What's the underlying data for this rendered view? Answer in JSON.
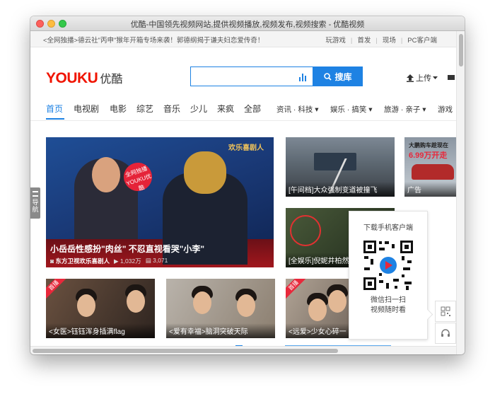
{
  "window": {
    "title": "优酷-中国领先视频网站,提供视频播放,视频发布,视频搜索 - 优酷视频"
  },
  "topbar": {
    "promo": "<全网独播>德云社\"丙申\"猴年开箱专场来袭！郭德纲揭于谦夫妇恋爱传奇！",
    "links": [
      "玩游戏",
      "首发",
      "现场",
      "PC客户端"
    ]
  },
  "header": {
    "logo_latin": "YOUKU",
    "logo_cn": "优酷",
    "search_placeholder": "",
    "search_button": "搜库",
    "upload": "上传"
  },
  "nav": {
    "items": [
      "首页",
      "电视剧",
      "电影",
      "综艺",
      "音乐",
      "少儿",
      "来疯",
      "全部"
    ],
    "subs": [
      "资讯 · 科技",
      "娱乐 · 搞笑",
      "旅游 · 亲子",
      "游戏"
    ],
    "active": "首页"
  },
  "sidetab": {
    "label": "导航"
  },
  "hero": {
    "stamp": "全网独播 YOUKU优酷",
    "show_logo": "欢乐喜剧人",
    "title": "小岳岳性感扮\"肉丝\" 不忍直视看哭\"小李\"",
    "channel": "东方卫视欢乐喜剧人",
    "views": "1,032万",
    "comments": "3,071"
  },
  "tiles": {
    "road": "[午间档]大众强制变道被撞飞",
    "ad_caption": "广告",
    "ad_text": "大鹏购车趁现在",
    "ad_price": "6.99万开走",
    "ent": "[全娱乐]倪妮井柏然",
    "a": "<女医>钰钰浑身插满flag",
    "b": "<爱有幸福>脑洞突破天际",
    "c": "<远爱>少女心碎一",
    "badge": "首播"
  },
  "qr_panel": {
    "title": "下载手机客户端",
    "line1": "微信扫一扫",
    "line2": "视频随时看"
  },
  "colors": {
    "accent": "#1e82e3",
    "brand_red": "#f01400"
  }
}
